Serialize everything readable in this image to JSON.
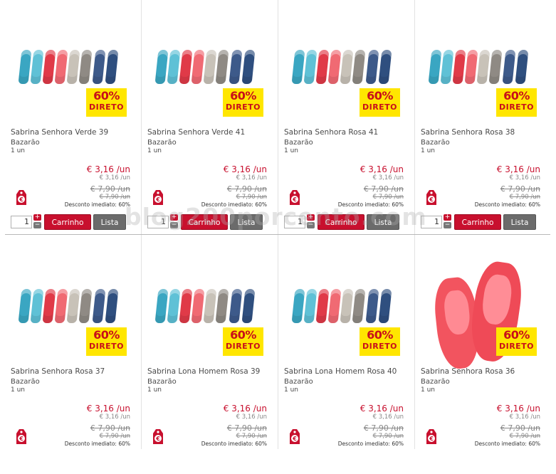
{
  "badge": {
    "percent": "60%",
    "label": "DIRETO"
  },
  "buttons": {
    "cart": "Carrinho",
    "list": "Lista"
  },
  "quantity_default": "1",
  "watermark": "blog200porcento.com",
  "colors": {
    "accent": "#c8102e",
    "badge_bg": "#ffe600",
    "button_gray": "#6b6b6b"
  },
  "products": [
    {
      "name": "Sabrina Senhora Verde 39",
      "brand": "Bazarão",
      "unit": "1 un",
      "price": "€ 3,16 /un",
      "price_sub": "€ 3,16 /un",
      "old_price": "€ 7,90 /un",
      "old_price_sub": "€ 7,90 /un",
      "discount": "Desconto imediato: 60%",
      "image": "multi-color-shoes"
    },
    {
      "name": "Sabrina Senhora Verde 41",
      "brand": "Bazarão",
      "unit": "1 un",
      "price": "€ 3,16 /un",
      "price_sub": "€ 3,16 /un",
      "old_price": "€ 7,90 /un",
      "old_price_sub": "€ 7,90 /un",
      "discount": "Desconto imediato: 60%",
      "image": "multi-color-shoes"
    },
    {
      "name": "Sabrina Senhora Rosa 41",
      "brand": "Bazarão",
      "unit": "1 un",
      "price": "€ 3,16 /un",
      "price_sub": "€ 3,16 /un",
      "old_price": "€ 7,90 /un",
      "old_price_sub": "€ 7,90 /un",
      "discount": "Desconto imediato: 60%",
      "image": "multi-color-shoes"
    },
    {
      "name": "Sabrina Senhora Rosa 38",
      "brand": "Bazarão",
      "unit": "1 un",
      "price": "€ 3,16 /un",
      "price_sub": "€ 3,16 /un",
      "old_price": "€ 7,90 /un",
      "old_price_sub": "€ 7,90 /un",
      "discount": "Desconto imediato: 60%",
      "image": "multi-color-shoes"
    },
    {
      "name": "Sabrina Senhora Rosa 37",
      "brand": "Bazarão",
      "unit": "1 un",
      "price": "€ 3,16 /un",
      "price_sub": "€ 3,16 /un",
      "old_price": "€ 7,90 /un",
      "old_price_sub": "€ 7,90 /un",
      "discount": "Desconto imediato: 60%",
      "image": "multi-color-shoes"
    },
    {
      "name": "Sabrina Lona Homem Rosa 39",
      "brand": "Bazarão",
      "unit": "1 un",
      "price": "€ 3,16 /un",
      "price_sub": "€ 3,16 /un",
      "old_price": "€ 7,90 /un",
      "old_price_sub": "€ 7,90 /un",
      "discount": "Desconto imediato: 60%",
      "image": "multi-color-shoes"
    },
    {
      "name": "Sabrina Lona Homem Rosa 40",
      "brand": "Bazarão",
      "unit": "1 un",
      "price": "€ 3,16 /un",
      "price_sub": "€ 3,16 /un",
      "old_price": "€ 7,90 /un",
      "old_price_sub": "€ 7,90 /un",
      "discount": "Desconto imediato: 60%",
      "image": "multi-color-shoes"
    },
    {
      "name": "Sabrina Senhora Rosa 36",
      "brand": "Bazarão",
      "unit": "1 un",
      "price": "€ 3,16 /un",
      "price_sub": "€ 3,16 /un",
      "old_price": "€ 7,90 /un",
      "old_price_sub": "€ 7,90 /un",
      "discount": "Desconto imediato: 60%",
      "image": "pink-shoes"
    }
  ]
}
